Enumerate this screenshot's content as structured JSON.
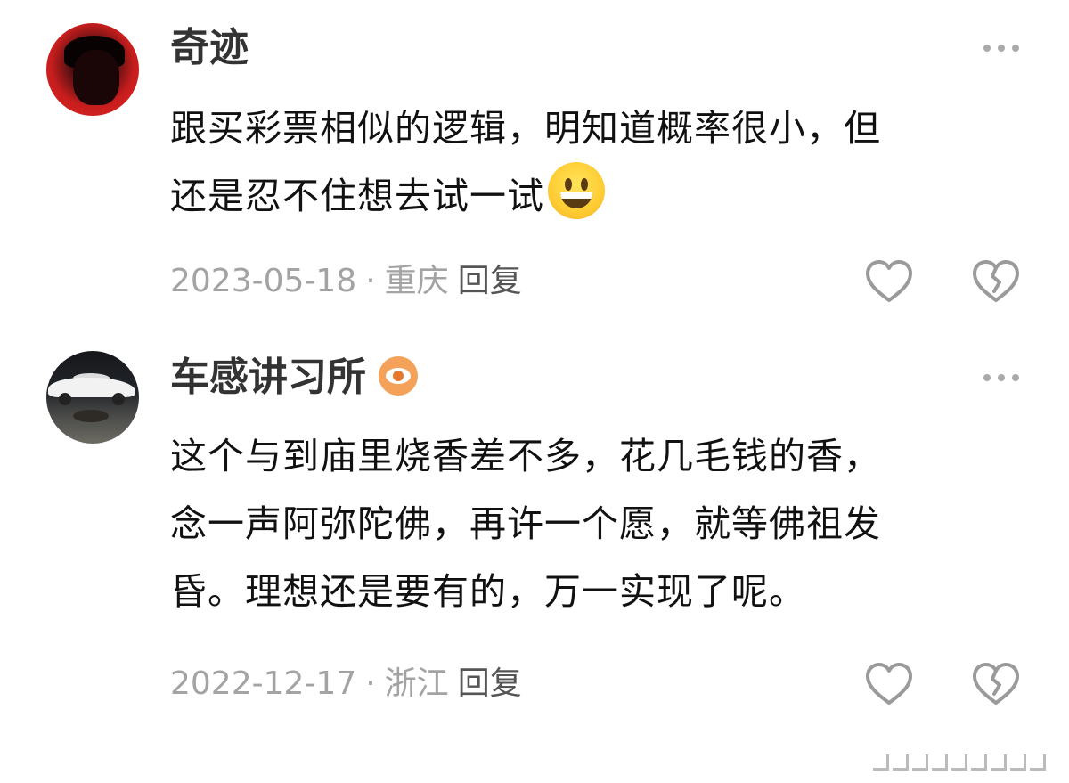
{
  "comments": [
    {
      "username": "奇迹",
      "avatar": "portrait-red-background",
      "content_lines": [
        "跟买彩票相似的逻辑，明知道概率很小，但",
        "还是忍不住想去试一试"
      ],
      "emoji": "grinning-face",
      "date": "2023-05-18",
      "separator": "·",
      "location": "重庆",
      "reply_label": "回复"
    },
    {
      "username": "车感讲习所",
      "avatar": "white-car-night",
      "badge": "eye-badge",
      "content_lines": [
        "这个与到庙里烧香差不多，花几毛钱的香，",
        "念一声阿弥陀佛，再许一个愿，就等佛祖发",
        "昏。理想还是要有的，万一实现了呢。"
      ],
      "date": "2022-12-17",
      "separator": "·",
      "location": "浙江",
      "reply_label": "回复"
    }
  ],
  "colors": {
    "username": "#333333",
    "content": "#111111",
    "meta": "#a3a3a3",
    "reply": "#555555",
    "icon": "#9a9a9a",
    "badge": "#f4a25a"
  }
}
